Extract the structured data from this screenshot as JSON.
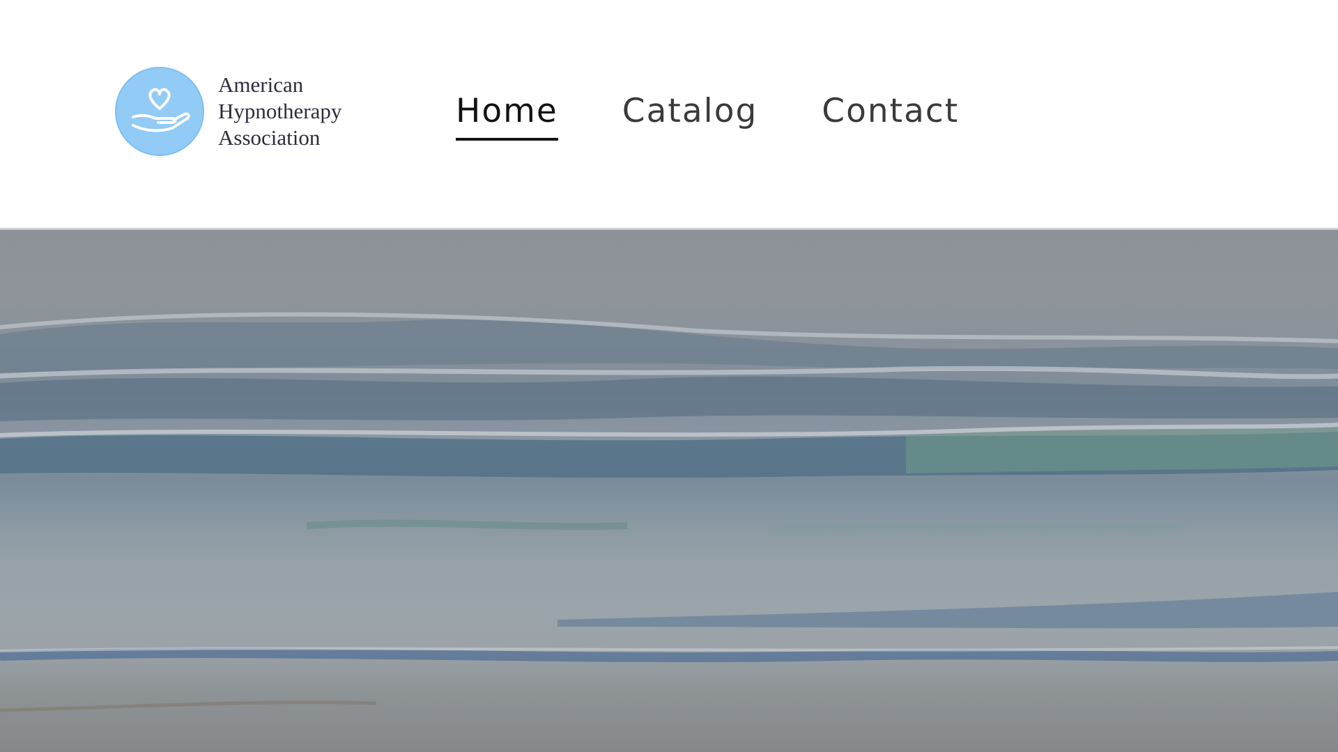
{
  "brand": {
    "name_lines": [
      "American",
      "Hypnotherapy",
      "Association"
    ],
    "logo_color": "#92cbf6"
  },
  "nav": {
    "items": [
      {
        "label": "Home",
        "active": true
      },
      {
        "label": "Catalog",
        "active": false
      },
      {
        "label": "Contact",
        "active": false
      }
    ]
  },
  "hero": {
    "image": "ocean waves on beach"
  }
}
